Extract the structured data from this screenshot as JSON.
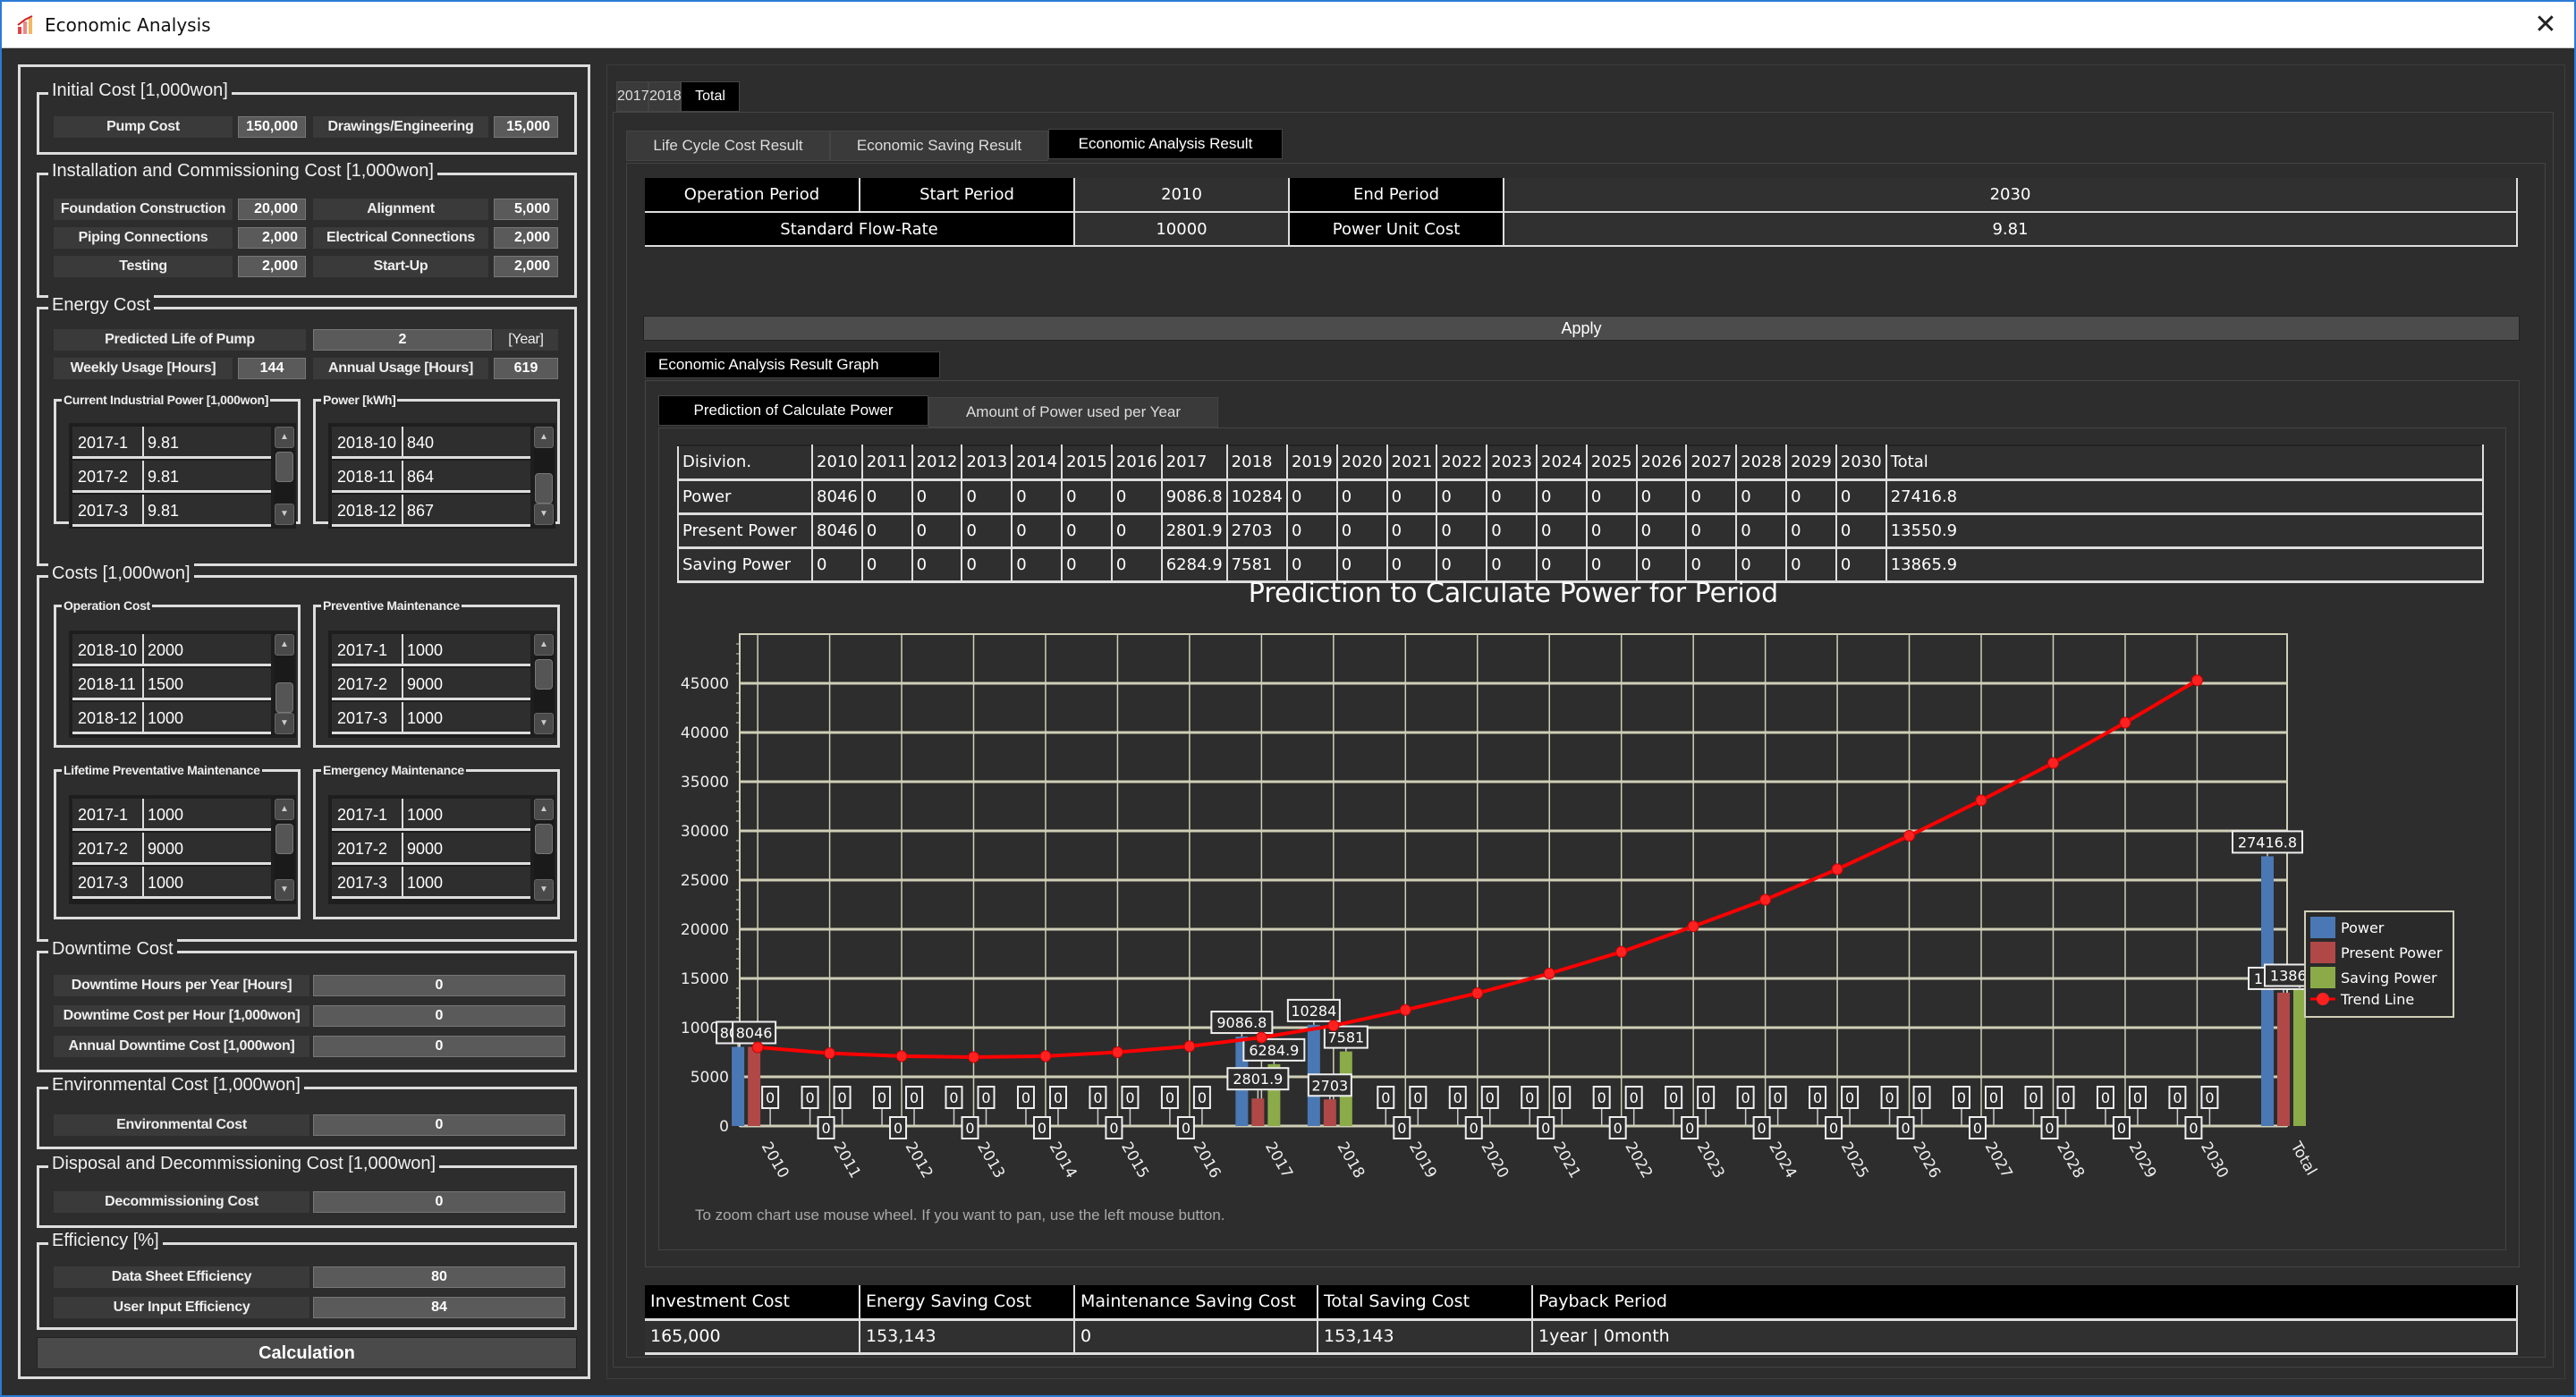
{
  "window": {
    "title": "Economic Analysis",
    "app_icon": "chart-app-icon",
    "close_icon": "close-icon"
  },
  "left": {
    "initial_cost": {
      "title": "Initial Cost [1,000won]",
      "fields": [
        {
          "label": "Pump Cost",
          "value": "150,000"
        },
        {
          "label": "Drawings/Engineering",
          "value": "15,000"
        }
      ]
    },
    "installation": {
      "title": "Installation and Commissioning Cost [1,000won]",
      "fields": [
        {
          "label": "Foundation Construction",
          "value": "20,000"
        },
        {
          "label": "Alignment",
          "value": "5,000"
        },
        {
          "label": "Piping Connections",
          "value": "2,000"
        },
        {
          "label": "Electrical Connections",
          "value": "2,000"
        },
        {
          "label": "Testing",
          "value": "2,000"
        },
        {
          "label": "Start-Up",
          "value": "2,000"
        }
      ]
    },
    "energy": {
      "title": "Energy Cost",
      "predicted_life": {
        "label": "Predicted Life of Pump",
        "value": "2",
        "unit": "[Year]"
      },
      "weekly": {
        "label": "Weekly Usage [Hours]",
        "value": "144"
      },
      "annual": {
        "label": "Annual Usage [Hours]",
        "value": "619"
      },
      "industrial_power": {
        "title": "Current Industrial Power [1,000won]",
        "rows": [
          {
            "k": "2017-1",
            "v": "9.81"
          },
          {
            "k": "2017-2",
            "v": "9.81"
          },
          {
            "k": "2017-3",
            "v": "9.81"
          }
        ]
      },
      "power_kwh": {
        "title": "Power [kWh]",
        "rows": [
          {
            "k": "2018-10",
            "v": "840"
          },
          {
            "k": "2018-11",
            "v": "864"
          },
          {
            "k": "2018-12",
            "v": "867"
          }
        ]
      }
    },
    "costs": {
      "title": "Costs [1,000won]",
      "operation": {
        "title": "Operation Cost",
        "rows": [
          {
            "k": "2018-10",
            "v": "2000"
          },
          {
            "k": "2018-11",
            "v": "1500"
          },
          {
            "k": "2018-12",
            "v": "1000"
          }
        ]
      },
      "preventive": {
        "title": "Preventive Maintenance",
        "rows": [
          {
            "k": "2017-1",
            "v": "1000"
          },
          {
            "k": "2017-2",
            "v": "9000"
          },
          {
            "k": "2017-3",
            "v": "1000"
          }
        ]
      },
      "lifetime": {
        "title": "Lifetime Preventative Maintenance",
        "rows": [
          {
            "k": "2017-1",
            "v": "1000"
          },
          {
            "k": "2017-2",
            "v": "9000"
          },
          {
            "k": "2017-3",
            "v": "1000"
          }
        ]
      },
      "emergency": {
        "title": "Emergency Maintenance",
        "rows": [
          {
            "k": "2017-1",
            "v": "1000"
          },
          {
            "k": "2017-2",
            "v": "9000"
          },
          {
            "k": "2017-3",
            "v": "1000"
          }
        ]
      }
    },
    "downtime": {
      "title": "Downtime Cost",
      "fields": [
        {
          "label": "Downtime Hours per Year [Hours]",
          "value": "0"
        },
        {
          "label": "Downtime Cost per Hour [1,000won]",
          "value": "0"
        },
        {
          "label": "Annual Downtime Cost [1,000won]",
          "value": "0"
        }
      ]
    },
    "environmental": {
      "title": "Environmental Cost [1,000won]",
      "fields": [
        {
          "label": "Environmental Cost",
          "value": "0"
        }
      ]
    },
    "disposal": {
      "title": "Disposal and Decommissioning Cost [1,000won]",
      "fields": [
        {
          "label": "Decommissioning Cost",
          "value": "0"
        }
      ]
    },
    "efficiency": {
      "title": "Efficiency [%]",
      "fields": [
        {
          "label": "Data Sheet Efficiency",
          "value": "80"
        },
        {
          "label": "User Input Efficiency",
          "value": "84"
        }
      ]
    },
    "calculation_label": "Calculation"
  },
  "right": {
    "year_tabs": [
      {
        "label": "2017"
      },
      {
        "label": "2018"
      },
      {
        "label": "Total",
        "active": true
      }
    ],
    "result_tabs": [
      {
        "label": "Life Cycle Cost Result"
      },
      {
        "label": "Economic Saving Result"
      },
      {
        "label": "Economic Analysis Result",
        "active": true
      }
    ],
    "info": {
      "operation_period": "Operation Period",
      "start_period_label": "Start Period",
      "start_period": "2010",
      "end_period_label": "End Period",
      "end_period": "2030",
      "flow_rate_label": "Standard Flow-Rate",
      "flow_rate": "10000",
      "unit_cost_label": "Power Unit Cost",
      "unit_cost": "9.81"
    },
    "apply_label": "Apply",
    "graph_group_label": "Economic Analysis Result Graph",
    "graph_tabs": [
      {
        "label": "Prediction of Calculate Power",
        "active": true
      },
      {
        "label": "Amount of Power used per Year"
      }
    ],
    "table": {
      "headers": [
        "Disivion.",
        "2010",
        "2011",
        "2012",
        "2013",
        "2014",
        "2015",
        "2016",
        "2017",
        "2018",
        "2019",
        "2020",
        "2021",
        "2022",
        "2023",
        "2024",
        "2025",
        "2026",
        "2027",
        "2028",
        "2029",
        "2030",
        "Total"
      ],
      "rows": [
        [
          "Power",
          "8046",
          "0",
          "0",
          "0",
          "0",
          "0",
          "0",
          "9086.8",
          "10284",
          "0",
          "0",
          "0",
          "0",
          "0",
          "0",
          "0",
          "0",
          "0",
          "0",
          "0",
          "0",
          "27416.8"
        ],
        [
          "Present Power",
          "8046",
          "0",
          "0",
          "0",
          "0",
          "0",
          "0",
          "2801.9",
          "2703",
          "0",
          "0",
          "0",
          "0",
          "0",
          "0",
          "0",
          "0",
          "0",
          "0",
          "0",
          "0",
          "13550.9"
        ],
        [
          "Saving Power",
          "0",
          "0",
          "0",
          "0",
          "0",
          "0",
          "0",
          "6284.9",
          "7581",
          "0",
          "0",
          "0",
          "0",
          "0",
          "0",
          "0",
          "0",
          "0",
          "0",
          "0",
          "0",
          "13865.9"
        ]
      ]
    },
    "hint": "To zoom chart use mouse wheel. If you want to pan, use the left mouse button.",
    "results": {
      "headers": [
        "Investment Cost",
        "Energy Saving Cost",
        "Maintenance Saving Cost",
        "Total Saving Cost",
        "Payback Period"
      ],
      "values": [
        "165,000",
        "153,143",
        "0",
        "153,143",
        "1year | 0month"
      ]
    }
  },
  "chart_data": {
    "type": "bar",
    "title": "Prediction to Calculate Power for Period",
    "xlabel": "",
    "ylabel": "",
    "categories": [
      "2010",
      "2011",
      "2012",
      "2013",
      "2014",
      "2015",
      "2016",
      "2017",
      "2018",
      "2019",
      "2020",
      "2021",
      "2022",
      "2023",
      "2024",
      "2025",
      "2026",
      "2027",
      "2028",
      "2029",
      "2030",
      "Total"
    ],
    "series": [
      {
        "name": "Power",
        "color": "#4a78b4",
        "values": [
          8046,
          0,
          0,
          0,
          0,
          0,
          0,
          9086.8,
          10284,
          0,
          0,
          0,
          0,
          0,
          0,
          0,
          0,
          0,
          0,
          0,
          0,
          27416.8
        ]
      },
      {
        "name": "Present Power",
        "color": "#b04848",
        "values": [
          8046,
          0,
          0,
          0,
          0,
          0,
          0,
          2801.9,
          2703,
          0,
          0,
          0,
          0,
          0,
          0,
          0,
          0,
          0,
          0,
          0,
          0,
          13550.9
        ]
      },
      {
        "name": "Saving Power",
        "color": "#8aab48",
        "values": [
          0,
          0,
          0,
          0,
          0,
          0,
          0,
          6284.9,
          7581,
          0,
          0,
          0,
          0,
          0,
          0,
          0,
          0,
          0,
          0,
          0,
          0,
          13865.9
        ]
      }
    ],
    "trend": {
      "name": "Trend Line",
      "type": "line",
      "color": "#ff0000",
      "x": [
        "2010",
        "2011",
        "2012",
        "2013",
        "2014",
        "2015",
        "2016",
        "2017",
        "2018",
        "2019",
        "2020",
        "2021",
        "2022",
        "2023",
        "2024",
        "2025",
        "2026",
        "2027",
        "2028",
        "2029",
        "2030"
      ],
      "values": [
        8000,
        7400,
        7100,
        7000,
        7100,
        7500,
        8100,
        9000,
        10200,
        11800,
        13500,
        15500,
        17700,
        20300,
        23000,
        26100,
        29500,
        33100,
        36900,
        41000,
        45300
      ]
    },
    "ylim": [
      0,
      50000
    ],
    "yticks": [
      0,
      5000,
      10000,
      15000,
      20000,
      25000,
      30000,
      35000,
      40000,
      45000
    ],
    "grid": true,
    "legend": "right",
    "data_labels": true
  }
}
